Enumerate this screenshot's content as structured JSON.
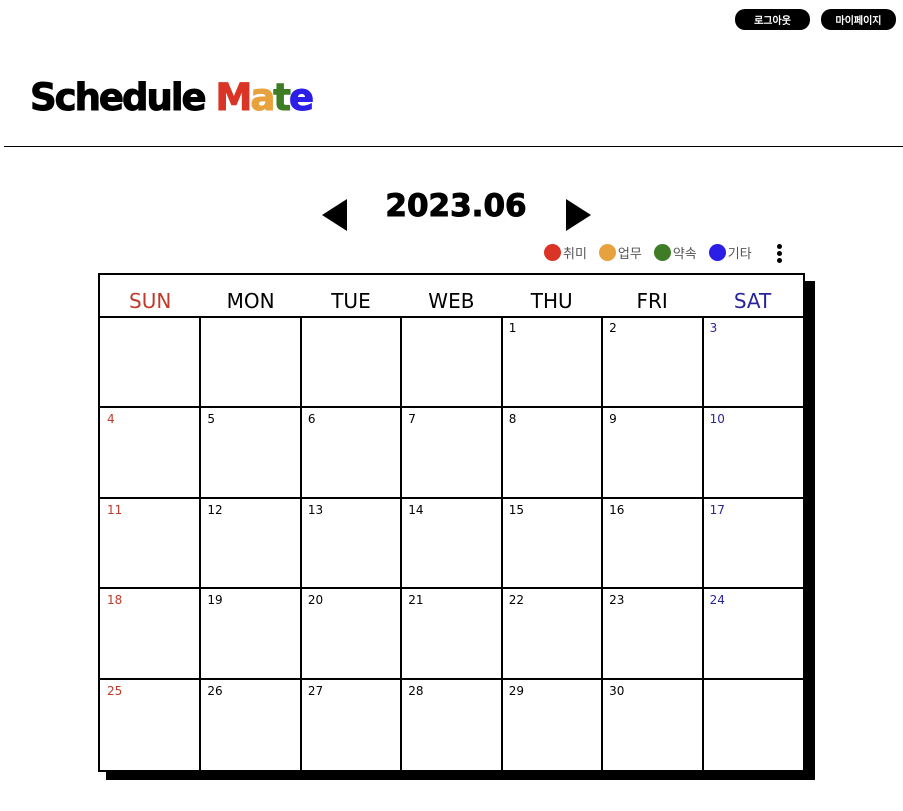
{
  "header": {
    "logout_label": "로그아웃",
    "mypage_label": "마이페이지",
    "logo": {
      "part1": "Schedule ",
      "letters": [
        {
          "char": "M",
          "color": "#d93425"
        },
        {
          "char": "a",
          "color": "#e8a23d"
        },
        {
          "char": "t",
          "color": "#3e7d25"
        },
        {
          "char": "e",
          "color": "#2b1ee6"
        }
      ]
    }
  },
  "calendar": {
    "title": "2023.06",
    "legend": [
      {
        "label": "취미",
        "color": "#d93425"
      },
      {
        "label": "업무",
        "color": "#e8a23d"
      },
      {
        "label": "약속",
        "color": "#3e7d25"
      },
      {
        "label": "기타",
        "color": "#2b1ee6"
      }
    ],
    "weekdays": [
      {
        "label": "SUN",
        "color": "#c0392b"
      },
      {
        "label": "MON",
        "color": "#000000"
      },
      {
        "label": "TUE",
        "color": "#000000"
      },
      {
        "label": "WEB",
        "color": "#000000"
      },
      {
        "label": "THU",
        "color": "#000000"
      },
      {
        "label": "FRI",
        "color": "#000000"
      },
      {
        "label": "SAT",
        "color": "#2a2499"
      }
    ],
    "weeks": [
      [
        "",
        "",
        "",
        "",
        "1",
        "2",
        "3"
      ],
      [
        "4",
        "5",
        "6",
        "7",
        "8",
        "9",
        "10"
      ],
      [
        "11",
        "12",
        "13",
        "14",
        "15",
        "16",
        "17"
      ],
      [
        "18",
        "19",
        "20",
        "21",
        "22",
        "23",
        "24"
      ],
      [
        "25",
        "26",
        "27",
        "28",
        "29",
        "30",
        ""
      ]
    ],
    "sunday_color": "#c0392b",
    "saturday_color": "#2a2499"
  }
}
